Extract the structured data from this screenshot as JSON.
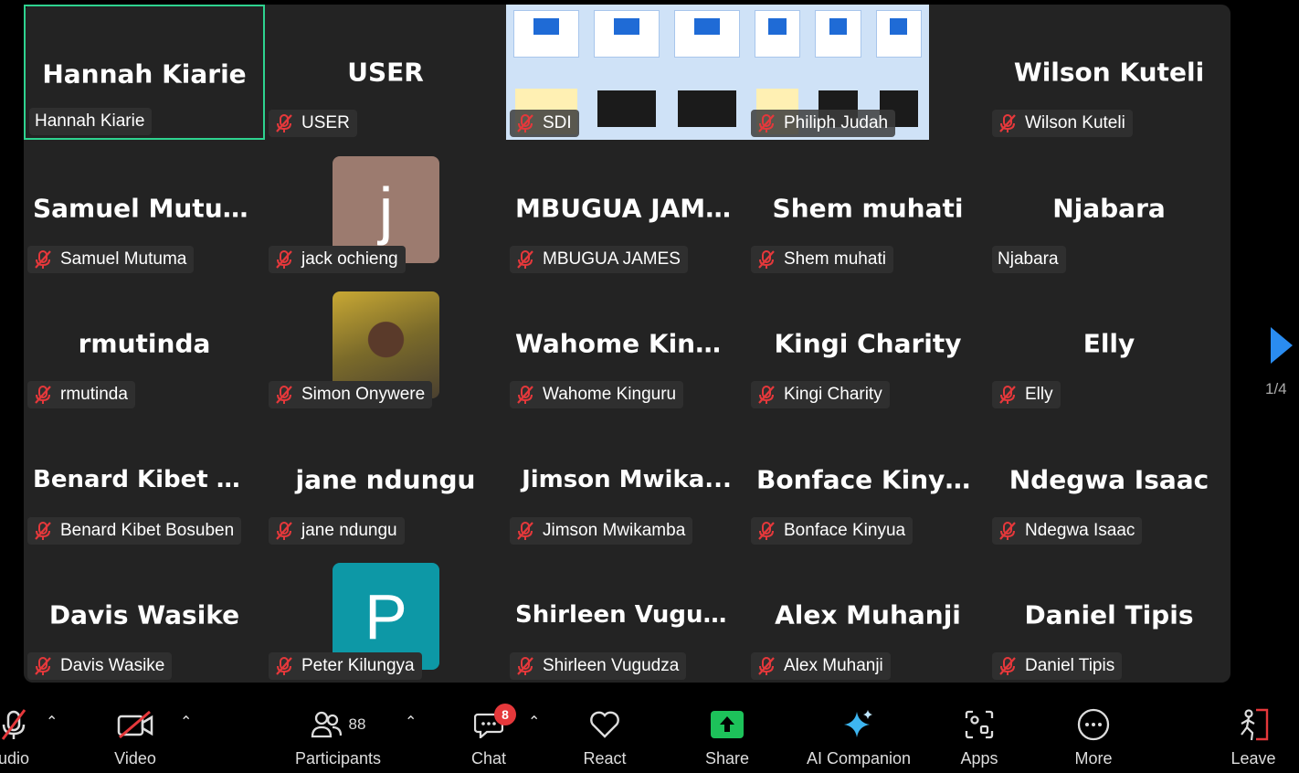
{
  "gallery": {
    "tiles": [
      {
        "display": "Hannah Kiarie",
        "label": "Hannah Kiarie",
        "muted": false,
        "active": true
      },
      {
        "display": "USER",
        "label": "USER",
        "muted": true
      },
      {
        "display": "",
        "label": "SDI",
        "muted": true,
        "kind": "screen"
      },
      {
        "display": "",
        "label": "Philiph Judah",
        "muted": true,
        "kind": "screen"
      },
      {
        "display": "Wilson Kuteli",
        "label": "Wilson Kuteli",
        "muted": true
      },
      {
        "display": "Samuel Mutuma",
        "label": "Samuel Mutuma",
        "muted": true
      },
      {
        "display": "",
        "label": "jack ochieng",
        "muted": true,
        "kind": "avatar",
        "avatar_letter": "j",
        "avatar_color": "#9c7b6f"
      },
      {
        "display": "MBUGUA JAMES",
        "label": "MBUGUA JAMES",
        "muted": true
      },
      {
        "display": "Shem muhati",
        "label": "Shem muhati",
        "muted": true
      },
      {
        "display": "Njabara",
        "label": "Njabara",
        "muted": false
      },
      {
        "display": "rmutinda",
        "label": "rmutinda",
        "muted": true
      },
      {
        "display": "",
        "label": "Simon Onywere",
        "muted": true,
        "kind": "photo"
      },
      {
        "display": "Wahome Kinguru",
        "label": "Wahome Kinguru",
        "muted": true
      },
      {
        "display": "Kingi Charity",
        "label": "Kingi Charity",
        "muted": true
      },
      {
        "display": "Elly",
        "label": "Elly",
        "muted": true
      },
      {
        "display": "Benard  Kibet  B...",
        "label": "Benard Kibet Bosuben",
        "muted": true
      },
      {
        "display": "jane ndungu",
        "label": "jane ndungu",
        "muted": true
      },
      {
        "display": "Jimson  Mwika...",
        "label": "Jimson Mwikamba",
        "muted": true
      },
      {
        "display": "Bonface Kinyua",
        "label": "Bonface Kinyua",
        "muted": true
      },
      {
        "display": "Ndegwa Isaac",
        "label": "Ndegwa Isaac",
        "muted": true
      },
      {
        "display": "Davis Wasike",
        "label": "Davis Wasike",
        "muted": true
      },
      {
        "display": "",
        "label": "Peter Kilungya",
        "muted": true,
        "kind": "avatar",
        "avatar_letter": "P",
        "avatar_color": "#0d98a6"
      },
      {
        "display": "Shirleen Vugudza",
        "label": "Shirleen Vugudza",
        "muted": true
      },
      {
        "display": "Alex Muhanji",
        "label": "Alex Muhanji",
        "muted": true
      },
      {
        "display": "Daniel Tipis",
        "label": "Daniel Tipis",
        "muted": true
      }
    ],
    "page_indicator": "1/4"
  },
  "toolbar": {
    "audio_label": "udio",
    "video_label": "Video",
    "participants_label": "Participants",
    "participants_count": "88",
    "chat_label": "Chat",
    "chat_badge": "8",
    "react_label": "React",
    "share_label": "Share",
    "ai_label": "AI Companion",
    "apps_label": "Apps",
    "more_label": "More",
    "leave_label": "Leave"
  },
  "colors": {
    "active_border": "#2ed28f",
    "mute_red": "#e5383b",
    "share_green": "#1dc25a",
    "nav_blue": "#2a8cf0"
  }
}
